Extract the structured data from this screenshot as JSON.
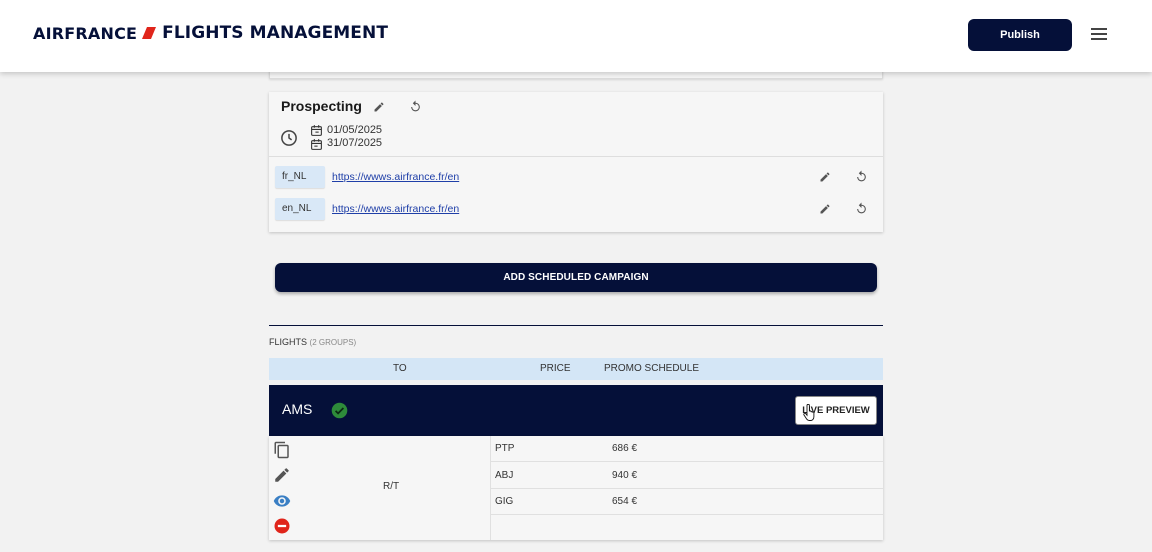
{
  "header": {
    "brand_airline": "AIRFRANCE",
    "brand_app": "FLIGHTS MANAGEMENT",
    "publish_label": "Publish",
    "accent_color": "#051039",
    "brand_red": "#e0251b"
  },
  "campaign": {
    "title": "Prospecting",
    "start_date": "01/05/2025",
    "end_date": "31/07/2025",
    "langs": [
      {
        "code": "fr_NL",
        "url": "https://wwws.airfrance.fr/en"
      },
      {
        "code": "en_NL",
        "url": "https://wwws.airfrance.fr/en"
      }
    ]
  },
  "add_campaign_label": "ADD SCHEDULED CAMPAIGN",
  "flights": {
    "label": "FLIGHTS",
    "groups_count": "(2 GROUPS)",
    "columns": [
      "TO",
      "PRICE",
      "PROMO SCHEDULE"
    ],
    "group": {
      "name": "AMS",
      "live_preview_label": "LIVE PREVIEW",
      "trip_type": "R/T",
      "rows": [
        {
          "dest": "PTP",
          "price": "686 €"
        },
        {
          "dest": "ABJ",
          "price": "940 €"
        },
        {
          "dest": "GIG",
          "price": "654 €"
        }
      ]
    }
  }
}
